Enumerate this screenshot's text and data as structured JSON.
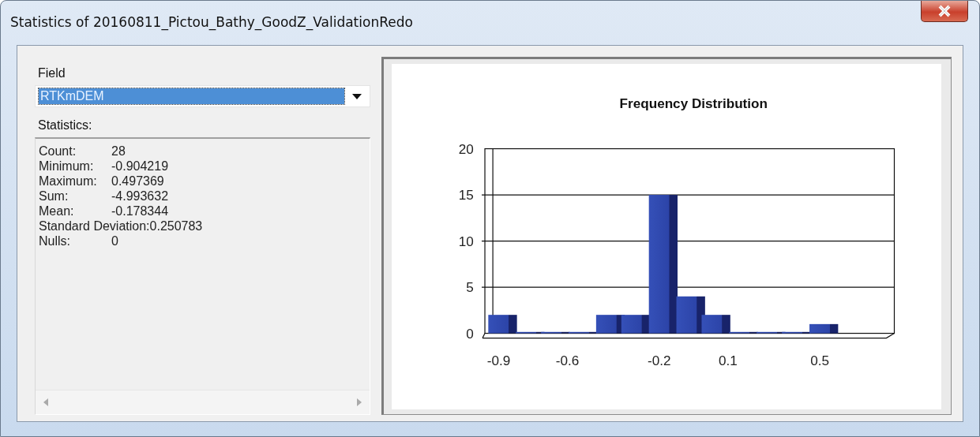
{
  "window": {
    "title": "Statistics of 20160811_Pictou_Bathy_GoodZ_ValidationRedo"
  },
  "field": {
    "label": "Field",
    "value": "RTKmDEM",
    "selected": true
  },
  "statistics": {
    "label": "Statistics:",
    "rows": [
      {
        "label": "Count:",
        "value": "28"
      },
      {
        "label": "Minimum:",
        "value": "-0.904219"
      },
      {
        "label": "Maximum:",
        "value": "0.497369"
      },
      {
        "label": "Sum:",
        "value": "-4.993632"
      },
      {
        "label": "Mean:",
        "value": "-0.178344"
      },
      {
        "label": "Standard Deviation:",
        "value": "0.250783"
      },
      {
        "label": "Nulls:",
        "value": "0"
      }
    ]
  },
  "chart": {
    "chart_data": {
      "type": "bar",
      "title": "Frequency Distribution",
      "x": [
        -0.9,
        -0.78,
        -0.67,
        -0.55,
        -0.43,
        -0.32,
        -0.2,
        -0.08,
        0.03,
        0.15,
        0.27,
        0.38,
        0.5
      ],
      "xlim": [
        -0.96,
        0.79
      ],
      "values": [
        2,
        0,
        0,
        0,
        2,
        2,
        15,
        4,
        2,
        0,
        0,
        0,
        1
      ],
      "ylim": [
        0,
        20
      ],
      "grid": true,
      "yticks": [
        0,
        5,
        10,
        15,
        20
      ],
      "xticks": [
        -0.9,
        -0.6,
        -0.2,
        0.1,
        0.5
      ]
    }
  }
}
